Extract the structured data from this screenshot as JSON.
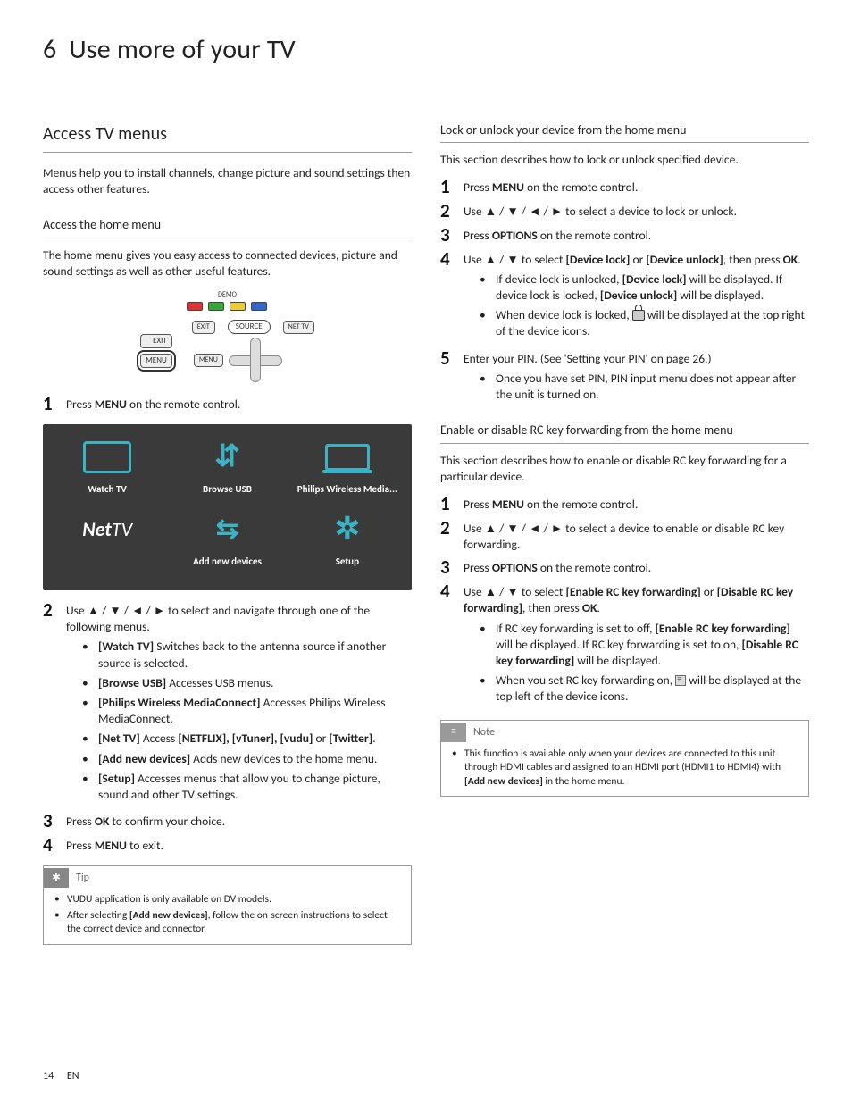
{
  "chapter": {
    "number": "6",
    "title": "Use more of your TV"
  },
  "left": {
    "section_title": "Access TV menus",
    "intro": "Menus help you to install channels, change picture and sound settings then access other features.",
    "sub1": {
      "title": "Access the home menu",
      "lead": "The home menu gives you easy access to connected devices, picture and sound settings as well as other useful features.",
      "remote": {
        "demo": "DEMO",
        "exit": "EXIT",
        "menu": "MENU",
        "source": "SOURCE",
        "nettv": "NET TV"
      },
      "step1": {
        "n": "1",
        "a": "Press ",
        "b": "MENU",
        "c": " on the remote control."
      },
      "tv": {
        "cells": [
          "Watch TV",
          "Browse USB",
          "Philips Wireless Media...",
          "NetTV",
          "Add new devices",
          "Setup"
        ]
      },
      "step2": {
        "n": "2",
        "a": "Use ",
        "arrows": "▲ / ▼ / ◄ / ►",
        "b": " to select and navigate through one of the following menus.",
        "items": [
          {
            "k": "[Watch TV]",
            "v": " Switches back to the antenna source if another source is selected."
          },
          {
            "k": "[Browse USB]",
            "v": " Accesses USB menus."
          },
          {
            "k": "[Philips Wireless MediaConnect]",
            "v": " Accesses Philips Wireless MediaConnect."
          },
          {
            "k": "[Net TV]",
            "v_a": " Access ",
            "v_list": "[NETFLIX], [vTuner], [vudu]",
            "v_b": " or ",
            "v_last": "[Twitter]",
            "v_c": "."
          },
          {
            "k": "[Add new devices]",
            "v": " Adds new devices to the home menu."
          },
          {
            "k": "[Setup]",
            "v": " Accesses menus that allow you to change picture, sound and other TV settings."
          }
        ]
      },
      "step3": {
        "n": "3",
        "a": "Press ",
        "b": "OK",
        "c": " to confirm your choice."
      },
      "step4": {
        "n": "4",
        "a": "Press ",
        "b": "MENU",
        "c": " to exit."
      },
      "tip": {
        "label": "Tip",
        "items": [
          {
            "t": "VUDU application is only available on DV models."
          },
          {
            "a": "After selecting ",
            "b": "[Add new devices]",
            "c": ", follow the on-screen instructions to select the correct device and connector."
          }
        ]
      }
    }
  },
  "right": {
    "sub1": {
      "title": "Lock or unlock your device from the home menu",
      "lead": "This section describes how to lock or unlock specified device.",
      "s1": {
        "n": "1",
        "a": "Press ",
        "b": "MENU",
        "c": " on the remote control."
      },
      "s2": {
        "n": "2",
        "a": "Use ",
        "arrows": "▲ / ▼ / ◄ / ►",
        "b": " to select a device to lock or unlock."
      },
      "s3": {
        "n": "3",
        "a": "Press ",
        "b": "OPTIONS",
        "c": " on the remote control."
      },
      "s4": {
        "n": "4",
        "a": "Use ",
        "arrows": "▲ / ▼",
        "b": " to select ",
        "opt1": "[Device lock]",
        "or": " or ",
        "opt2": "[Device unlock]",
        "c": ", then press ",
        "ok": "OK",
        "d": ".",
        "bullets": [
          {
            "a": "If device lock is unlocked, ",
            "b1": "[Device lock]",
            "c": " will be displayed. If device lock is locked, ",
            "b2": "[Device unlock]",
            "d": " will be displayed."
          },
          {
            "a": "When device lock is locked, ",
            "c": " will be displayed at the top right of the device icons."
          }
        ]
      },
      "s5": {
        "n": "5",
        "a": "Enter your PIN. (See 'Setting your PIN' on page 26.)",
        "bullets": [
          {
            "t": "Once you have set PIN, PIN input menu does not appear after the unit is turned on."
          }
        ]
      }
    },
    "sub2": {
      "title": "Enable or disable RC key forwarding from the home menu",
      "lead": "This section describes how to enable or disable RC key forwarding for a particular device.",
      "s1": {
        "n": "1",
        "a": "Press ",
        "b": "MENU",
        "c": " on the remote control."
      },
      "s2": {
        "n": "2",
        "a": "Use ",
        "arrows": "▲ / ▼ / ◄ / ►",
        "b": " to select a device to enable or disable RC key forwarding."
      },
      "s3": {
        "n": "3",
        "a": "Press ",
        "b": "OPTIONS",
        "c": " on the remote control."
      },
      "s4": {
        "n": "4",
        "a": "Use ",
        "arrows": "▲ / ▼",
        "b": " to select ",
        "opt1": "[Enable RC key forwarding]",
        "or": " or ",
        "opt2": "[Disable RC key forwarding]",
        "c": ", then press ",
        "ok": "OK",
        "d": ".",
        "bullets": [
          {
            "a": "If RC key forwarding is set to off, ",
            "b1": "[Enable RC key forwarding]",
            "c": " will be displayed. If RC key forwarding is set to on, ",
            "b2": "[Disable RC key forwarding]",
            "d": " will be displayed."
          },
          {
            "a": "When you set RC key forwarding on, ",
            "c": " will be displayed at the top left of the device icons."
          }
        ]
      },
      "note": {
        "label": "Note",
        "items": [
          {
            "a": "This function is available only when your devices are connected to this unit through HDMI cables and assigned to an HDMI port (HDMI1 to HDMI4) with ",
            "b": "[Add new devices]",
            "c": " in the home menu."
          }
        ]
      }
    }
  },
  "footer": {
    "page": "14",
    "lang": "EN"
  }
}
